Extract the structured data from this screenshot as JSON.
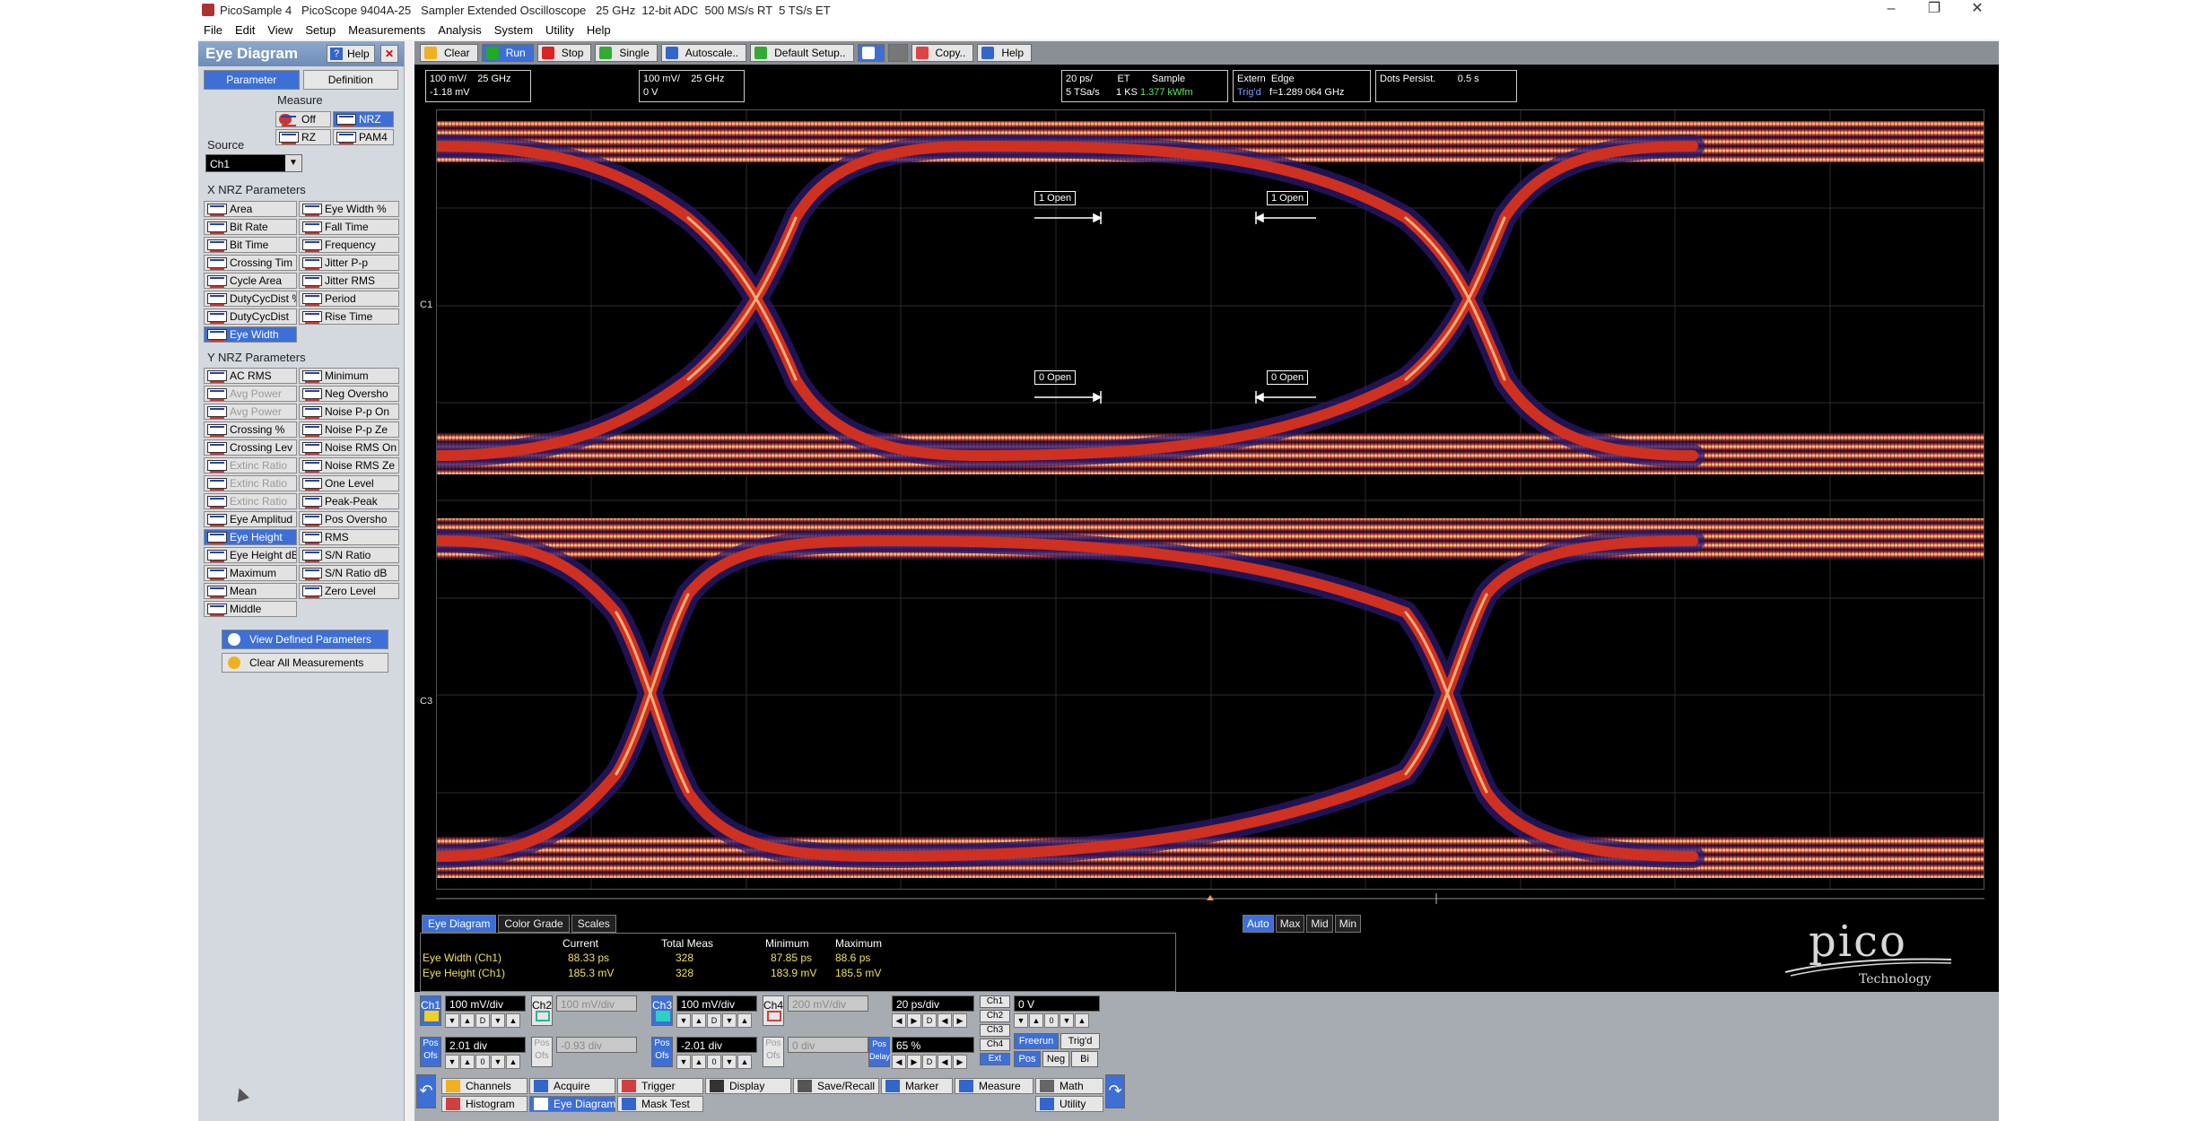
{
  "titlebar": {
    "title": "PicoSample 4   PicoScope 9404A-25   Sampler Extended Oscilloscope   25 GHz  12-bit ADC  500 MS/s RT  5 TS/s ET",
    "minimize": "–",
    "maximize": "❐",
    "close": "✕"
  },
  "menu": [
    "File",
    "Edit",
    "View",
    "Setup",
    "Measurements",
    "Analysis",
    "System",
    "Utility",
    "Help"
  ],
  "left_panel": {
    "title": "Eye Diagram",
    "help_label": "Help",
    "close_label": "✕",
    "tabs": [
      "Parameter",
      "Definition"
    ],
    "measure_label": "Measure",
    "measure_options": [
      "Off",
      "NRZ",
      "RZ",
      "PAM4"
    ],
    "source_label": "Source",
    "source_value": "Ch1",
    "x_section": "X NRZ Parameters",
    "x_params_left": [
      "Area",
      "Bit Rate",
      "Bit Time",
      "Crossing Tim",
      "Cycle Area",
      "DutyCycDist %",
      "DutyCycDist",
      "Eye Width"
    ],
    "x_params_right": [
      "Eye Width %",
      "Fall Time",
      "Frequency",
      "Jitter P-p",
      "Jitter RMS",
      "Period",
      "Rise Time"
    ],
    "y_section": "Y NRZ Parameters",
    "y_params_left": [
      "AC RMS",
      "Avg Power",
      "Avg Power",
      "Crossing %",
      "Crossing Lev",
      "Extinc Ratio",
      "Extinc Ratio",
      "Extinc Ratio",
      "Eye Amplitud",
      "Eye Height",
      "Eye Height dB",
      "Maximum",
      "Mean",
      "Middle"
    ],
    "y_params_right": [
      "Minimum",
      "Neg Oversho",
      "Noise P-p On",
      "Noise P-p Ze",
      "Noise RMS On",
      "Noise RMS Ze",
      "One Level",
      "Peak-Peak",
      "Pos Oversho",
      "RMS",
      "S/N Ratio",
      "S/N Ratio dB",
      "Zero Level"
    ],
    "view_defined": "View Defined Parameters",
    "clear_all": "Clear All Measurements"
  },
  "toolbar": {
    "buttons": [
      "Clear",
      "Run",
      "Stop",
      "Single",
      "Autoscale..",
      "Default Setup..",
      "",
      "",
      "Copy..",
      "Help"
    ]
  },
  "info": {
    "ch1_line1": "100 mV/    25 GHz",
    "ch1_line2": "-1.18 mV",
    "ch3_line1": "100 mV/    25 GHz",
    "ch3_line2": "0 V",
    "tb_line1": "20 ps/         ET        Sample",
    "tb_line2a": "5 TSa/s      1 KS",
    "tb_line2b": "1.377 kWfm",
    "trig_line1": "Extern  Edge",
    "trig_line2a": "Trig'd",
    "trig_line2b": "f=1.289 064 GHz",
    "persist_line": "Dots Persist.        0.5 s"
  },
  "plot": {
    "ch1_marker": "C1",
    "ch3_marker": "C3",
    "markers": [
      "1 Open",
      "1 Open",
      "0 Open",
      "0 Open"
    ]
  },
  "meas_tabs": [
    "Eye Diagram",
    "Color Grade",
    "Scales"
  ],
  "scale_buttons": [
    "Auto",
    "Max",
    "Mid",
    "Min"
  ],
  "meas_table": {
    "headers": [
      "Current",
      "Total Meas",
      "Minimum",
      "Maximum"
    ],
    "rows": [
      {
        "name": "Eye Width (Ch1)",
        "current": "88.33 ps",
        "total": "328",
        "min": "87.85 ps",
        "max": "88.6 ps"
      },
      {
        "name": "Eye Height (Ch1)",
        "current": "185.3 mV",
        "total": "328",
        "min": "183.9 mV",
        "max": "185.5 mV"
      }
    ]
  },
  "logo": {
    "text": "pico",
    "sub": "Technology"
  },
  "bottom": {
    "ch1": {
      "label": "Ch1",
      "scale": "100 mV/div",
      "offset": "2.01 div"
    },
    "ch2": {
      "label": "Ch2",
      "scale": "100 mV/div",
      "offset": "-0.93 div"
    },
    "ch3": {
      "label": "Ch3",
      "scale": "100 mV/div",
      "offset": "-2.01 div"
    },
    "ch4": {
      "label": "Ch4",
      "scale": "200 mV/div",
      "offset": "0 div"
    },
    "pos_label": "Pos",
    "ofs_label": "Ofs",
    "timebase": "20 ps/div",
    "delay_pct": "65 %",
    "pos_delay_1": "Pos",
    "pos_delay_2": "Delay",
    "trig_sources": [
      "Ch1",
      "Ch2",
      "Ch3",
      "Ch4",
      "Ext"
    ],
    "trig_level": "0 V",
    "freerun": "Freerun",
    "trigd": "Trig'd",
    "slopes": [
      "Pos",
      "Neg",
      "Bi"
    ],
    "nav_row1": [
      "Channels",
      "Acquire",
      "Trigger",
      "Display",
      "Save/Recall",
      "Marker",
      "Measure",
      "Math"
    ],
    "nav_row2": [
      "Histogram",
      "Eye Diagram",
      "Mask Test",
      "Utility"
    ]
  },
  "colors": {
    "accent": "#3d6fd6",
    "scope_bg": "#000000",
    "eye_hot": "#ffe0a0",
    "eye_mid": "#e04020",
    "eye_cool": "#3a30a0"
  }
}
